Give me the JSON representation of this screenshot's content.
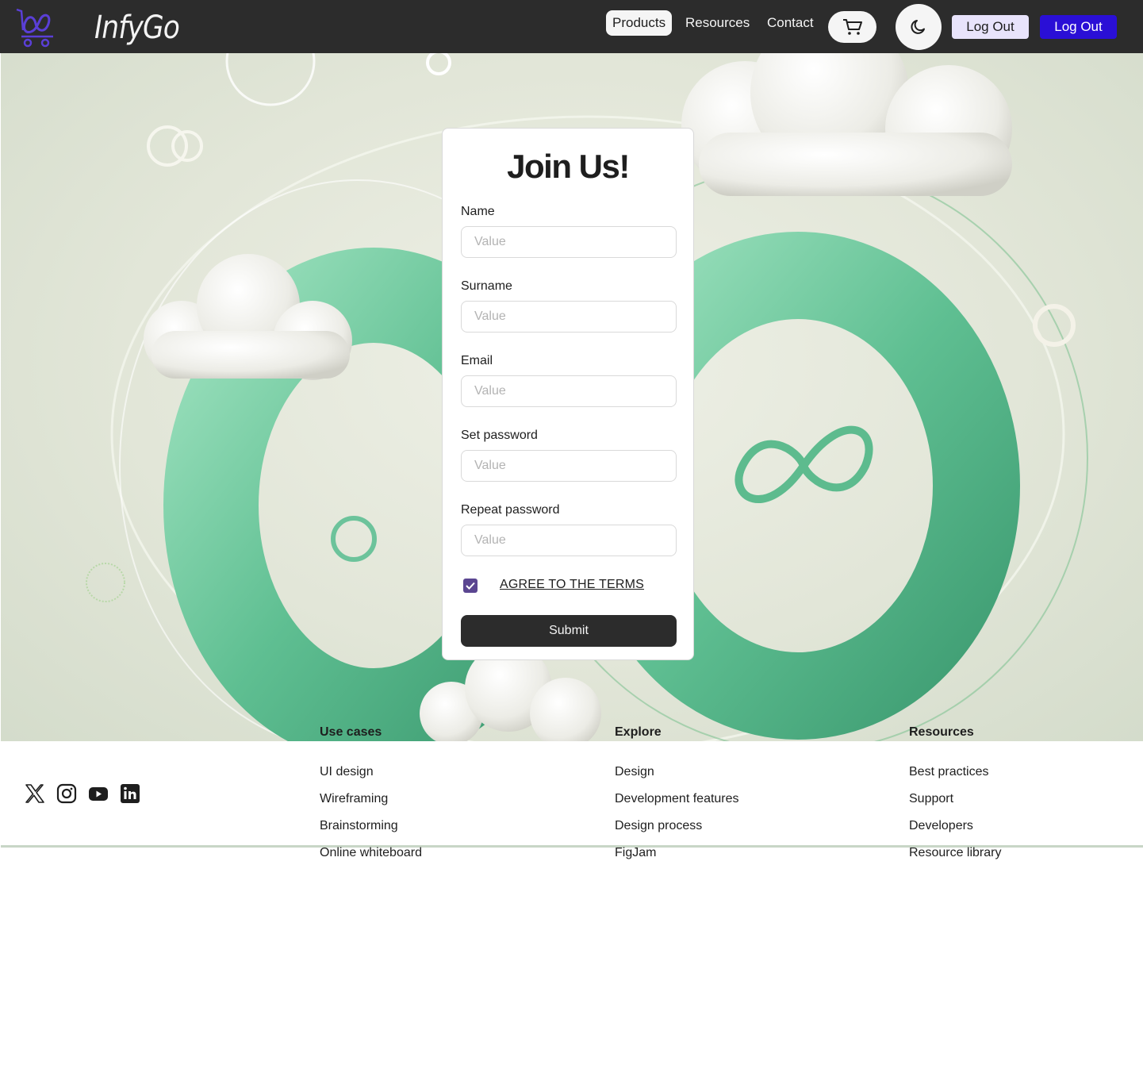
{
  "header": {
    "brand": "InfyGo",
    "nav": [
      {
        "label": "Products",
        "active": true
      },
      {
        "label": "Resources",
        "active": false
      },
      {
        "label": "Contact",
        "active": false
      }
    ],
    "logout_light_label": "Log Out",
    "logout_dark_label": "Log Out",
    "icons": {
      "logo": "infinity-cart-logo-icon",
      "cart": "cart-icon",
      "theme": "moon-icon"
    }
  },
  "form": {
    "title": "Join Us!",
    "fields": [
      {
        "label": "Name",
        "placeholder": "Value",
        "value": ""
      },
      {
        "label": "Surname",
        "placeholder": "Value",
        "value": ""
      },
      {
        "label": "Email",
        "placeholder": "Value",
        "value": ""
      },
      {
        "label": "Set password",
        "placeholder": "Value",
        "value": ""
      },
      {
        "label": "Repeat password",
        "placeholder": "Value",
        "value": ""
      }
    ],
    "terms_label": "AGREE TO THE TERMS",
    "terms_checked": true,
    "submit_label": "Submit"
  },
  "footer": {
    "social_icons": [
      "x-icon",
      "instagram-icon",
      "youtube-icon",
      "linkedin-icon"
    ],
    "columns": [
      {
        "title": "Use cases",
        "links": [
          "UI design",
          "Wireframing",
          "Brainstorming",
          "Online whiteboard"
        ]
      },
      {
        "title": "Explore",
        "links": [
          "Design",
          "Development features",
          "Design process",
          "FigJam"
        ]
      },
      {
        "title": "Resources",
        "links": [
          "Best practices",
          "Support",
          "Developers",
          "Resource library"
        ]
      }
    ]
  },
  "colors": {
    "nav_bg": "#2c2c2c",
    "accent": "#2a0fd6",
    "accent_light": "#e8e3fb",
    "checkbox": "#5b4691",
    "hero_green": "#6cc39b"
  }
}
